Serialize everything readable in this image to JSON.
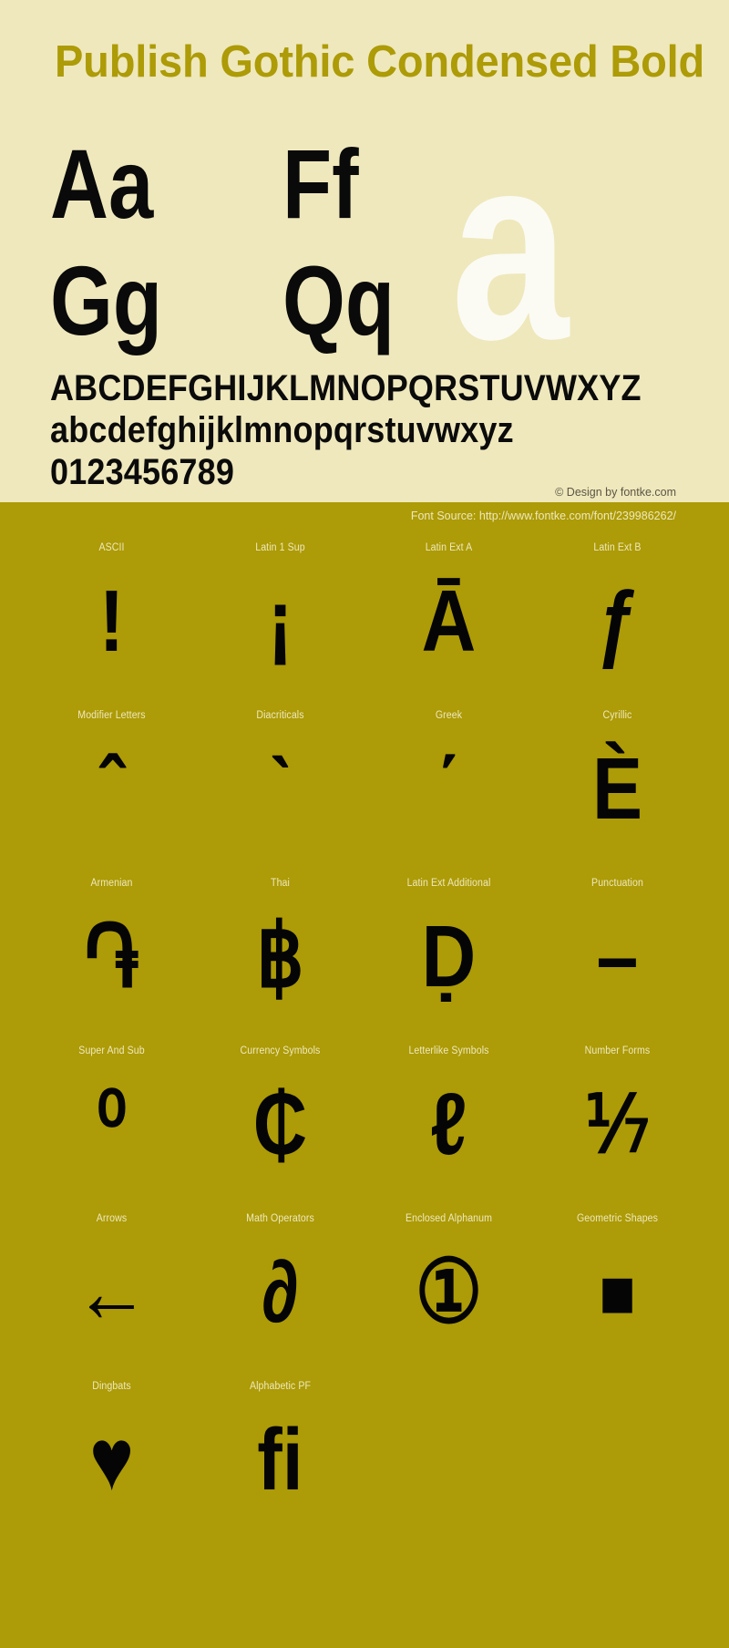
{
  "meta": {
    "font_title": "Publish Gothic Condensed Bold",
    "title_color": "#AD9B07",
    "panel_background": "#EFE8BC",
    "glyph_panel_background": "#AD9B07",
    "glyph_text_color": "#050505",
    "label_color": "#EFE8BC"
  },
  "specimen": {
    "pairs": {
      "aa": "Aa",
      "ff": "Ff",
      "gg": "Gg",
      "qq": "Qq",
      "watermark": "a"
    },
    "uppercase": "ABCDEFGHIJKLMNOPQRSTUVWXYZ",
    "lowercase": "abcdefghijklmnopqrstuvwxyz",
    "digits": "0123456789",
    "design_credit": "© Design by fontke.com"
  },
  "source": {
    "label": "Font Source: http://www.fontke.com/font/239986262/"
  },
  "glyph_grid": {
    "rows": [
      {
        "cells": [
          {
            "label": "ASCII",
            "glyph": "!",
            "icon": "exclamation-glyph"
          },
          {
            "label": "Latin 1 Sup",
            "glyph": "¡",
            "icon": "inverted-exclamation-glyph"
          },
          {
            "label": "Latin Ext A",
            "glyph": "Ā",
            "icon": "a-macron-glyph"
          },
          {
            "label": "Latin Ext B",
            "glyph": "ƒ",
            "icon": "florin-glyph"
          }
        ]
      },
      {
        "cells": [
          {
            "label": "Modifier Letters",
            "glyph": "ˆ",
            "icon": "circumflex-glyph"
          },
          {
            "label": "Diacriticals",
            "glyph": "ˋ",
            "icon": "grave-accent-glyph"
          },
          {
            "label": "Greek",
            "glyph": "΄",
            "icon": "greek-tonos-glyph"
          },
          {
            "label": "Cyrillic",
            "glyph": "Ѐ",
            "icon": "cyrillic-ie-grave-glyph"
          }
        ]
      },
      {
        "cells": [
          {
            "label": "Armenian",
            "glyph": "֏",
            "icon": "armenian-dram-glyph"
          },
          {
            "label": "Thai",
            "glyph": "฿",
            "icon": "thai-baht-glyph"
          },
          {
            "label": "Latin Ext Additional",
            "glyph": "Ḍ",
            "icon": "d-dot-below-glyph"
          },
          {
            "label": "Punctuation",
            "glyph": "–",
            "icon": "en-dash-glyph"
          }
        ]
      },
      {
        "cells": [
          {
            "label": "Super And Sub",
            "glyph": "⁰",
            "icon": "superscript-zero-glyph"
          },
          {
            "label": "Currency Symbols",
            "glyph": "₵",
            "icon": "cedi-sign-glyph"
          },
          {
            "label": "Letterlike Symbols",
            "glyph": "ℓ",
            "icon": "script-small-l-glyph"
          },
          {
            "label": "Number Forms",
            "glyph": "⅐",
            "icon": "one-seventh-fraction-glyph"
          }
        ]
      },
      {
        "cells": [
          {
            "label": "Arrows",
            "glyph": "←",
            "icon": "left-arrow-glyph"
          },
          {
            "label": "Math Operators",
            "glyph": "∂",
            "icon": "partial-differential-glyph"
          },
          {
            "label": "Enclosed Alphanum",
            "glyph": "①",
            "icon": "circled-one-glyph"
          },
          {
            "label": "Geometric Shapes",
            "glyph": "■",
            "icon": "filled-square-glyph"
          }
        ]
      },
      {
        "cells": [
          {
            "label": "Dingbats",
            "glyph": "♥",
            "icon": "heart-glyph"
          },
          {
            "label": "Alphabetic PF",
            "glyph": "ﬁ",
            "icon": "fi-ligature-glyph"
          }
        ]
      }
    ]
  }
}
